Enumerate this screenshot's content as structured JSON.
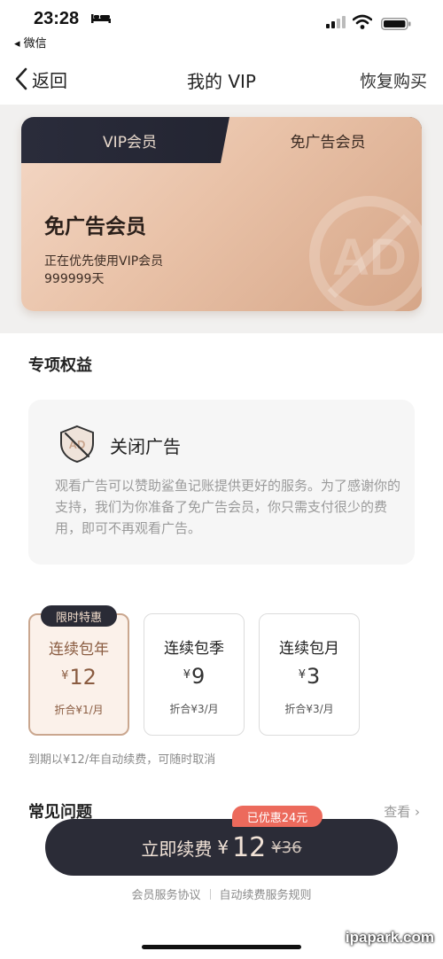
{
  "status_bar": {
    "time": "23:28",
    "back_app": "◂ 微信"
  },
  "nav": {
    "back_label": "返回",
    "title": "我的 VIP",
    "restore": "恢复购买"
  },
  "card": {
    "tab_vip": "VIP会员",
    "tab_adfree": "免广告会员",
    "title": "免广告会员",
    "status_line": "正在优先使用VIP会员",
    "days": "999999天",
    "watermark": "AD"
  },
  "benefits": {
    "section_title": "专项权益",
    "item_title": "关闭广告",
    "item_desc": "观看广告可以赞助鲨鱼记账提供更好的服务。为了感谢你的支持，我们为你准备了免广告会员，你只需支付很少的费用，即可不再观看广告。"
  },
  "plans": {
    "promo_badge": "限时特惠",
    "items": [
      {
        "name": "连续包年",
        "currency": "¥",
        "price": "12",
        "unit": "折合¥1/月"
      },
      {
        "name": "连续包季",
        "currency": "¥",
        "price": "9",
        "unit": "折合¥3/月"
      },
      {
        "name": "连续包月",
        "currency": "¥",
        "price": "3",
        "unit": "折合¥3/月"
      }
    ],
    "renew_note": "到期以¥12/年自动续费，可随时取消"
  },
  "faq": {
    "title": "常见问题",
    "more": "查看 ›"
  },
  "cta": {
    "discount_badge": "已优惠24元",
    "label": "立即续费",
    "currency": "¥",
    "price": "12",
    "original_price": "¥36"
  },
  "footer_links": {
    "agreement": "会员服务协议",
    "auto_renew_rules": "自动续费服务规则"
  },
  "watermark": "ipapark.com",
  "colors": {
    "dark": "#2b2c37",
    "gold": "#caa78f",
    "accent_red": "#ec6a5c"
  }
}
